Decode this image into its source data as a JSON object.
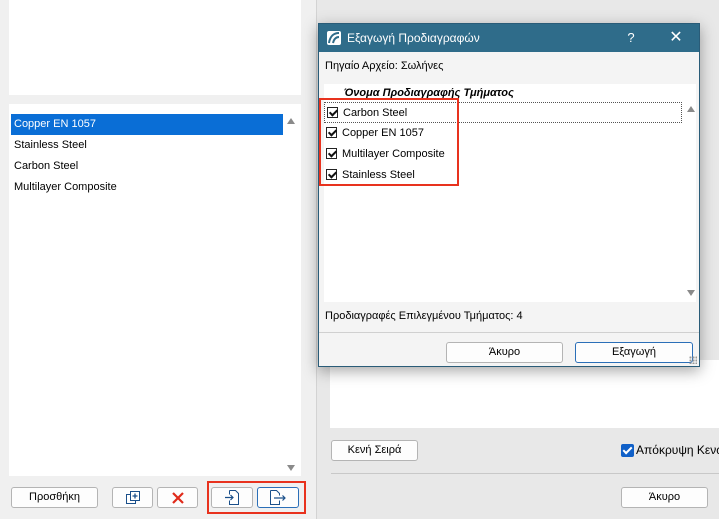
{
  "left": {
    "list_items": [
      {
        "label": "Copper EN 1057",
        "selected": true
      },
      {
        "label": "Stainless Steel",
        "selected": false
      },
      {
        "label": "Carbon Steel",
        "selected": false
      },
      {
        "label": "Multilayer Composite",
        "selected": false
      }
    ],
    "add_button": "Προσθήκη"
  },
  "right": {
    "empty_row_button": "Κενή Σειρά",
    "hide_empty_label": "Απόκρυψη Κενώ",
    "hide_empty_checked": true,
    "cancel_button": "Άκυρο"
  },
  "dialog": {
    "title": "Εξαγωγή Προδιαγραφών",
    "help": "?",
    "close": "✕",
    "source_file": "Πηγαίο Αρχείο: Σωλήνες",
    "column_header": "Όνομα Προδιαγραφής Τμήματος",
    "rows": [
      {
        "label": "Carbon Steel",
        "checked": true
      },
      {
        "label": "Copper EN 1057",
        "checked": true
      },
      {
        "label": "Multilayer Composite",
        "checked": true
      },
      {
        "label": "Stainless Steel",
        "checked": true
      }
    ],
    "selected_count": "Προδιαγραφές Επιλεγμένου Τμήματος: 4",
    "cancel_button": "Άκυρο",
    "export_button": "Εξαγωγή"
  },
  "colors": {
    "titlebar": "#2f6c8a",
    "selection": "#0a6ed6",
    "highlight": "#e8321e"
  }
}
